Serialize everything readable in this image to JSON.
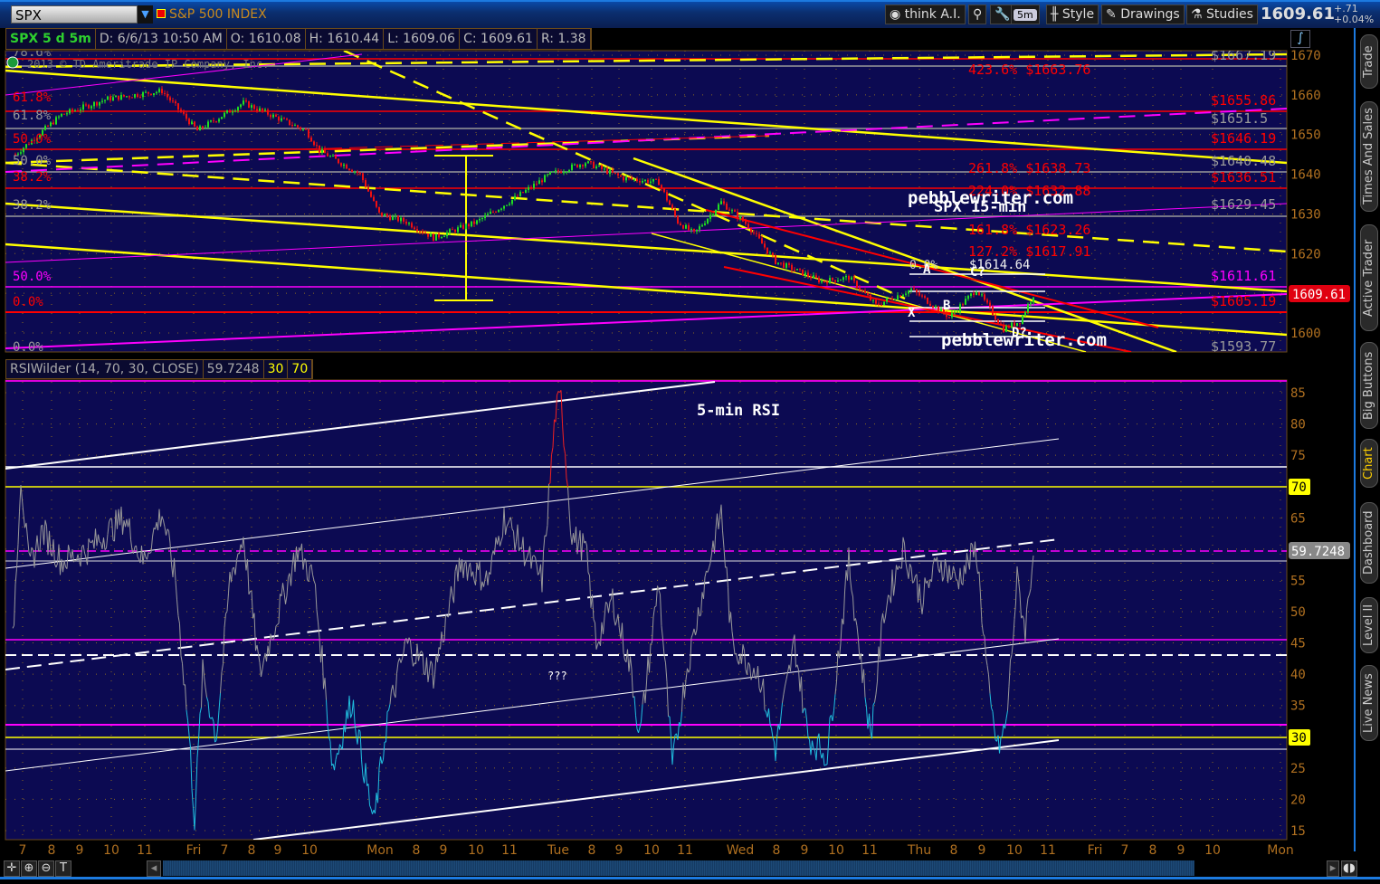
{
  "toolbar": {
    "symbol": "SPX",
    "symbol_name": "S&P 500 INDEX",
    "think_ai": "think A.I.",
    "interval": "5m",
    "style": "Style",
    "drawings": "Drawings",
    "studies": "Studies",
    "last": "1609.61",
    "change": "+.71",
    "change_pct": "+0.04%"
  },
  "header": {
    "title": "SPX 5 d 5m",
    "date": "D: 6/6/13 10:50 AM",
    "open": "O: 1610.08",
    "high": "H: 1610.44",
    "low": "L: 1609.06",
    "close": "C: 1609.61",
    "range": "R: 1.38"
  },
  "watermark": "2013 © TD Ameritrade IP Company, Inc.",
  "price_axis": {
    "ticks": [
      "1670",
      "1660",
      "1650",
      "1640",
      "1630",
      "1620",
      "1610",
      "1600"
    ],
    "last_label": "1609.61"
  },
  "fib_left": [
    {
      "t": "78.6%",
      "c": "#888"
    },
    {
      "t": "61.8%",
      "c": "#f00"
    },
    {
      "t": "61.8%",
      "c": "#999"
    },
    {
      "t": "50.0%",
      "c": "#f00"
    },
    {
      "t": "50.0%",
      "c": "#999"
    },
    {
      "t": "38.2%",
      "c": "#f00"
    },
    {
      "t": "38.2%",
      "c": "#999"
    },
    {
      "t": "50.0%",
      "c": "#f0f"
    },
    {
      "t": "0.0%",
      "c": "#f00"
    },
    {
      "t": "0.0%",
      "c": "#999"
    }
  ],
  "fib_right": [
    {
      "t": "$1667.19",
      "c": "#999"
    },
    {
      "t": "$1655.86",
      "c": "#f00"
    },
    {
      "t": "$1651.5",
      "c": "#999"
    },
    {
      "t": "$1646.19",
      "c": "#f00"
    },
    {
      "t": "$1640.48",
      "c": "#999"
    },
    {
      "t": "$1636.51",
      "c": "#f00"
    },
    {
      "t": "$1629.45",
      "c": "#999"
    },
    {
      "t": "$1611.61",
      "c": "#f0f"
    },
    {
      "t": "$1605.19",
      "c": "#f00"
    },
    {
      "t": "$1593.77",
      "c": "#999"
    }
  ],
  "extensions": [
    "423.6%  $1663.76",
    "261.8%  $1638.73",
    "224.0%  $1632.88",
    "161.8%  $1623.26",
    "127.2%  $1617.91",
    "0.0%",
    "$1614.64"
  ],
  "annotations": {
    "site1": "pebblewriter.com",
    "chart_label": "SPX 15-min",
    "site2": "pebblewriter.com",
    "pt_x": "X",
    "pt_a": "A",
    "pt_b": "B",
    "pt_c": "C?",
    "pt_d": "D?",
    "rsi_label": "5-min RSI",
    "question": "???"
  },
  "rsi": {
    "study": "RSIWilder (14, 70, 30, CLOSE)",
    "value": "59.7248",
    "ob": "30",
    "os": "70",
    "ticks": [
      "85",
      "80",
      "75",
      "70",
      "65",
      "60",
      "55",
      "50",
      "45",
      "40",
      "35",
      "30",
      "25",
      "20",
      "15"
    ],
    "box_70": "70",
    "box_30": "30",
    "box_value": "59.7248"
  },
  "time_axis": [
    "7",
    "8",
    "9",
    "10",
    "11",
    "Fri",
    "7",
    "8",
    "9",
    "10",
    "Mon",
    "8",
    "9",
    "10",
    "11",
    "Tue",
    "8",
    "9",
    "10",
    "11",
    "Wed",
    "8",
    "9",
    "10",
    "11",
    "Thu",
    "8",
    "9",
    "10",
    "11",
    "Fri",
    "7",
    "8",
    "9",
    "10",
    "Mon"
  ],
  "side_tabs": [
    "Trade",
    "Times And Sales",
    "Active Trader",
    "Big Buttons",
    "Chart",
    "Dashboard",
    "Level II",
    "Live News"
  ],
  "chart_data": {
    "type": "line",
    "title": "SPX 5 d 5m",
    "price_series": {
      "name": "SPX",
      "x_unit": "5-min bar index",
      "points": [
        [
          3,
          1645
        ],
        [
          20,
          1655
        ],
        [
          37,
          1659
        ],
        [
          57,
          1661
        ],
        [
          70,
          1651
        ],
        [
          87,
          1658
        ],
        [
          110,
          1651
        ],
        [
          115,
          1646
        ],
        [
          130,
          1640
        ],
        [
          137,
          1630
        ],
        [
          147,
          1628
        ],
        [
          157,
          1624
        ],
        [
          173,
          1628
        ],
        [
          187,
          1634
        ],
        [
          200,
          1640
        ],
        [
          213,
          1643
        ],
        [
          227,
          1639
        ],
        [
          240,
          1638
        ],
        [
          247,
          1628
        ],
        [
          253,
          1625
        ],
        [
          263,
          1633
        ],
        [
          273,
          1627
        ],
        [
          283,
          1618
        ],
        [
          300,
          1613
        ],
        [
          310,
          1614
        ],
        [
          320,
          1607
        ],
        [
          333,
          1611
        ],
        [
          347,
          1604
        ],
        [
          357,
          1611
        ],
        [
          367,
          1601
        ],
        [
          373,
          1603
        ],
        [
          378,
          1609.61
        ]
      ]
    },
    "price_ylim": [
      1592,
      1672
    ],
    "rsi_series": {
      "name": "RSIWilder",
      "points": [
        [
          2,
          45
        ],
        [
          5,
          72
        ],
        [
          8,
          57
        ],
        [
          13,
          63
        ],
        [
          20,
          58
        ],
        [
          30,
          60
        ],
        [
          43,
          65
        ],
        [
          50,
          58
        ],
        [
          57,
          66
        ],
        [
          62,
          55
        ],
        [
          67,
          30
        ],
        [
          69,
          17
        ],
        [
          72,
          40
        ],
        [
          77,
          30
        ],
        [
          82,
          55
        ],
        [
          87,
          62
        ],
        [
          93,
          40
        ],
        [
          100,
          50
        ],
        [
          107,
          60
        ],
        [
          113,
          55
        ],
        [
          120,
          25
        ],
        [
          127,
          36
        ],
        [
          135,
          16
        ],
        [
          140,
          33
        ],
        [
          147,
          45
        ],
        [
          157,
          40
        ],
        [
          167,
          58
        ],
        [
          177,
          55
        ],
        [
          183,
          65
        ],
        [
          190,
          60
        ],
        [
          197,
          55
        ],
        [
          202,
          82
        ],
        [
          204,
          84
        ],
        [
          208,
          62
        ],
        [
          213,
          60
        ],
        [
          217,
          45
        ],
        [
          223,
          52
        ],
        [
          230,
          40
        ],
        [
          233,
          30
        ],
        [
          240,
          55
        ],
        [
          245,
          25
        ],
        [
          250,
          40
        ],
        [
          257,
          55
        ],
        [
          263,
          66
        ],
        [
          267,
          45
        ],
        [
          277,
          40
        ],
        [
          283,
          28
        ],
        [
          290,
          45
        ],
        [
          295,
          30
        ],
        [
          302,
          27
        ],
        [
          310,
          58
        ],
        [
          318,
          30
        ],
        [
          323,
          50
        ],
        [
          330,
          60
        ],
        [
          337,
          52
        ],
        [
          343,
          58
        ],
        [
          350,
          55
        ],
        [
          357,
          60
        ],
        [
          362,
          35
        ],
        [
          365,
          28
        ],
        [
          368,
          32
        ],
        [
          372,
          55
        ],
        [
          375,
          47
        ],
        [
          378,
          59.72
        ]
      ]
    },
    "rsi_ylim": [
      14,
      87
    ],
    "rsi_levels": [
      70,
      30
    ]
  }
}
